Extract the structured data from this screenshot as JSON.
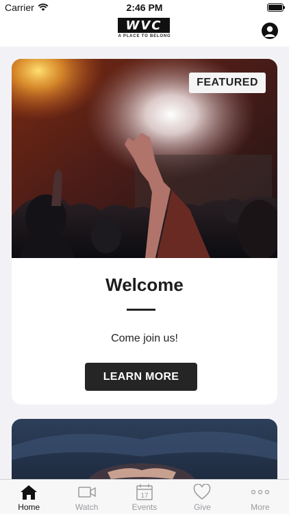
{
  "status_bar": {
    "carrier": "Carrier",
    "time": "2:46 PM"
  },
  "header": {
    "logo_text": "WVC",
    "logo_tagline": "A PLACE TO BELONG"
  },
  "featured_card": {
    "badge": "FEATURED",
    "title": "Welcome",
    "subtitle": "Come join us!",
    "button_label": "LEARN MORE"
  },
  "tabs": [
    {
      "label": "Home",
      "icon": "home-icon",
      "active": true
    },
    {
      "label": "Watch",
      "icon": "video-icon",
      "active": false
    },
    {
      "label": "Events",
      "icon": "calendar-icon",
      "active": false
    },
    {
      "label": "Give",
      "icon": "heart-icon",
      "active": false
    },
    {
      "label": "More",
      "icon": "more-icon",
      "active": false
    }
  ],
  "calendar_day": "17",
  "colors": {
    "accent": "#252525",
    "inactive_tab": "#9a9a9f",
    "background": "#f2f2f6"
  }
}
